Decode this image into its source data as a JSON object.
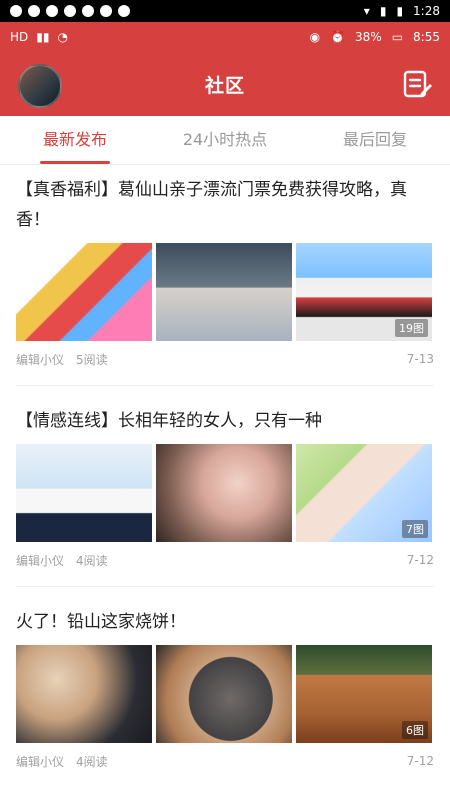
{
  "system_bar": {
    "time": "1:28"
  },
  "status_bar": {
    "battery": "38%",
    "time": "8:55"
  },
  "header": {
    "title": "社区"
  },
  "tabs": [
    {
      "label": "最新发布",
      "active": true
    },
    {
      "label": "24小时热点",
      "active": false
    },
    {
      "label": "最后回复",
      "active": false
    }
  ],
  "posts": [
    {
      "title": "【真香福利】葛仙山亲子漂流门票免费获得攻略，真香！",
      "image_count_label": "19图",
      "author": "编辑小仪",
      "reads": "5阅读",
      "date": "7-13"
    },
    {
      "title": "【情感连线】长相年轻的女人，只有一种",
      "image_count_label": "7图",
      "author": "编辑小仪",
      "reads": "4阅读",
      "date": "7-12"
    },
    {
      "title": "火了！铅山这家烧饼！",
      "image_count_label": "6图",
      "author": "编辑小仪",
      "reads": "4阅读",
      "date": "7-12"
    }
  ],
  "colors": {
    "brand": "#d6403f"
  },
  "icons": {
    "edit": "edit-note-icon",
    "avatar": "user-avatar"
  }
}
